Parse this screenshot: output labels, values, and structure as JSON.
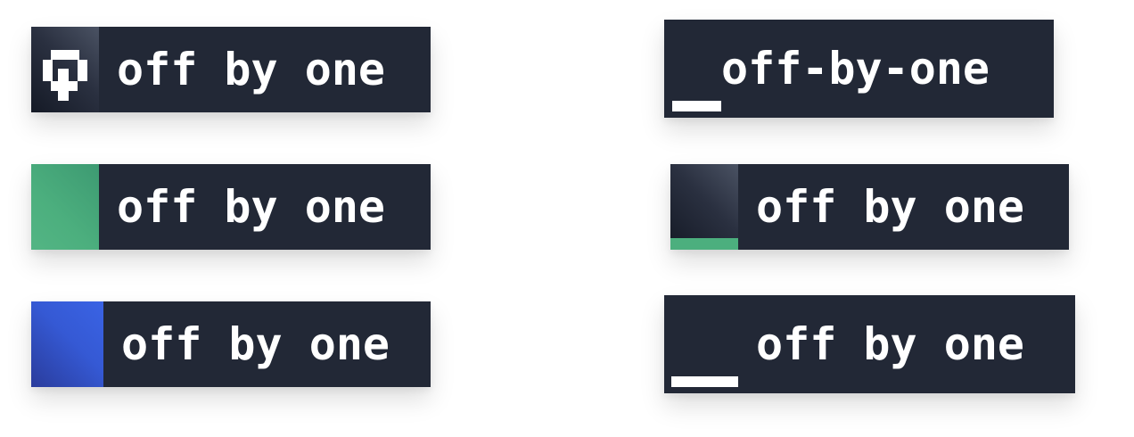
{
  "logos": [
    {
      "label": "off by one",
      "variant": "pixel-glyph-square"
    },
    {
      "label": "off-by-one",
      "variant": "underscore-cursor"
    },
    {
      "label": "off by one",
      "variant": "green-square"
    },
    {
      "label": "off by one",
      "variant": "dark-square-green-bar"
    },
    {
      "label": "off by one",
      "variant": "blue-square"
    },
    {
      "label": "off by one",
      "variant": "underscore-wide"
    }
  ],
  "colors": {
    "background": "#ffffff",
    "panel": "#222836",
    "text": "#ffffff",
    "green": "#4caf7e",
    "blue": "#3559d4",
    "dark_square": "#2a3040"
  }
}
